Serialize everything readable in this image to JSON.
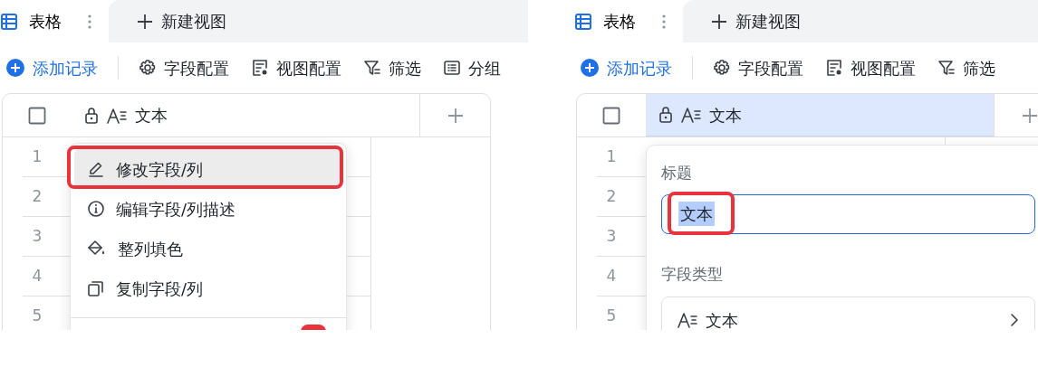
{
  "panels": [
    {
      "tabs": [
        {
          "kind": "view",
          "label": "表格",
          "selected": true
        },
        {
          "kind": "new",
          "label": "新建视图",
          "selected": false
        }
      ],
      "toolbar": {
        "add_label": "添加记录",
        "buttons": [
          {
            "kind": "gear",
            "label": "字段配置"
          },
          {
            "kind": "view",
            "label": "视图配置"
          },
          {
            "kind": "filter",
            "label": "筛选"
          },
          {
            "kind": "group",
            "label": "分组"
          }
        ]
      },
      "table": {
        "column": "文本",
        "column_selected": false,
        "rows": [
          "1",
          "2",
          "3",
          "4",
          "5"
        ]
      },
      "popup": {
        "kind": "menu",
        "items": [
          {
            "kind": "edit",
            "label": "修改字段/列",
            "hovered": true,
            "annotated": true
          },
          {
            "kind": "info",
            "label": "编辑字段/列描述",
            "hovered": false,
            "annotated": false
          },
          {
            "kind": "fill",
            "label": "整列填色",
            "hovered": false,
            "annotated": false
          },
          {
            "kind": "copy",
            "label": "复制字段/列",
            "hovered": false,
            "annotated": false
          }
        ]
      }
    },
    {
      "tabs": [
        {
          "kind": "view",
          "label": "表格",
          "selected": true
        },
        {
          "kind": "new",
          "label": "新建视图",
          "selected": false
        }
      ],
      "toolbar": {
        "add_label": "添加记录",
        "buttons": [
          {
            "kind": "gear",
            "label": "字段配置"
          },
          {
            "kind": "view",
            "label": "视图配置"
          },
          {
            "kind": "filter",
            "label": "筛选"
          }
        ]
      },
      "table": {
        "column": "文本",
        "column_selected": true,
        "rows": [
          "1",
          "2",
          "3",
          "4",
          "5"
        ]
      },
      "popup": {
        "kind": "editor",
        "title_label": "标题",
        "title_value": "文本",
        "value_selected": true,
        "annotated": true,
        "type_label": "字段类型",
        "type_value": "文本"
      }
    }
  ]
}
